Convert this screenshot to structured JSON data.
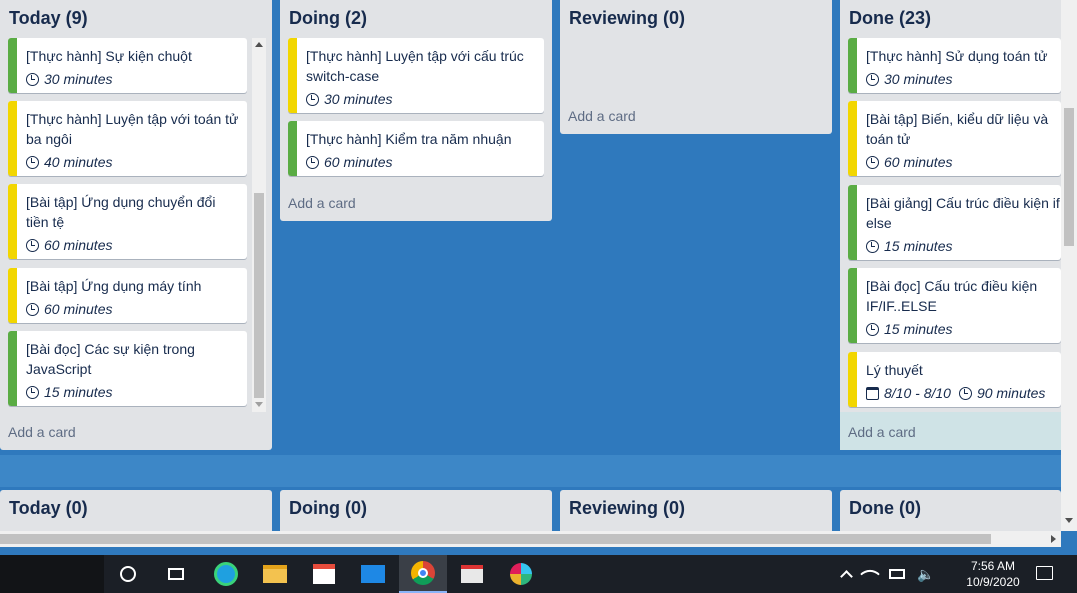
{
  "boards": {
    "top": {
      "lists": [
        {
          "title": "Today (9)",
          "cards": [
            {
              "title": "[Thực hành] Sự kiện chuột",
              "time": "30 minutes",
              "color": "green"
            },
            {
              "title": "[Thực hành] Luyện tập với toán tử ba ngôi",
              "time": "40 minutes",
              "color": "yellow"
            },
            {
              "title": "[Bài tập] Ứng dụng chuyển đổi tiền tệ",
              "time": "60 minutes",
              "color": "yellow"
            },
            {
              "title": "[Bài tập] Ứng dụng máy tính",
              "time": "60 minutes",
              "color": "yellow"
            },
            {
              "title": "[Bài đọc] Các sự kiện trong JavaScript",
              "time": "15 minutes",
              "color": "green"
            }
          ],
          "add_card": "Add a card"
        },
        {
          "title": "Doing (2)",
          "cards": [
            {
              "title": "[Thực hành] Luyện tập với cấu trúc switch-case",
              "time": "30 minutes",
              "color": "yellow"
            },
            {
              "title": "[Thực hành] Kiểm tra năm nhuận",
              "time": "60 minutes",
              "color": "green"
            }
          ],
          "add_card": "Add a card"
        },
        {
          "title": "Reviewing (0)",
          "cards": [],
          "add_card": "Add a card"
        },
        {
          "title": "Done (23)",
          "cards": [
            {
              "title": "[Thực hành] Sử dụng toán tử",
              "time": "30 minutes",
              "color": "green"
            },
            {
              "title": "[Bài tập] Biến, kiểu dữ liệu và toán tử",
              "time": "60 minutes",
              "color": "yellow"
            },
            {
              "title": "[Bài giảng] Cấu trúc điều kiện if else",
              "time": "15 minutes",
              "color": "green"
            },
            {
              "title": "[Bài đọc] Cấu trúc điều kiện IF/IF..ELSE",
              "time": "15 minutes",
              "color": "green"
            },
            {
              "title": "Lý thuyết",
              "date": "8/10 - 8/10",
              "time": "90 minutes",
              "color": "yellow"
            }
          ],
          "add_card": "Add a card"
        }
      ]
    },
    "bottom": {
      "lists": [
        {
          "title": "Today (0)"
        },
        {
          "title": "Doing (0)"
        },
        {
          "title": "Reviewing (0)"
        },
        {
          "title": "Done (0)"
        }
      ]
    }
  },
  "taskbar": {
    "icons": [
      "search-circle-icon",
      "task-view-icon",
      "edge-icon",
      "file-explorer-icon",
      "store-icon",
      "mail-icon",
      "chrome-icon",
      "app-icon",
      "slack-icon"
    ],
    "time": "7:56 AM",
    "date": "10/9/2020"
  },
  "colors": {
    "board_bg": "#2f79bd",
    "list_bg": "#e1e3e6",
    "label_green": "#5aac44",
    "label_yellow": "#f2d600"
  }
}
